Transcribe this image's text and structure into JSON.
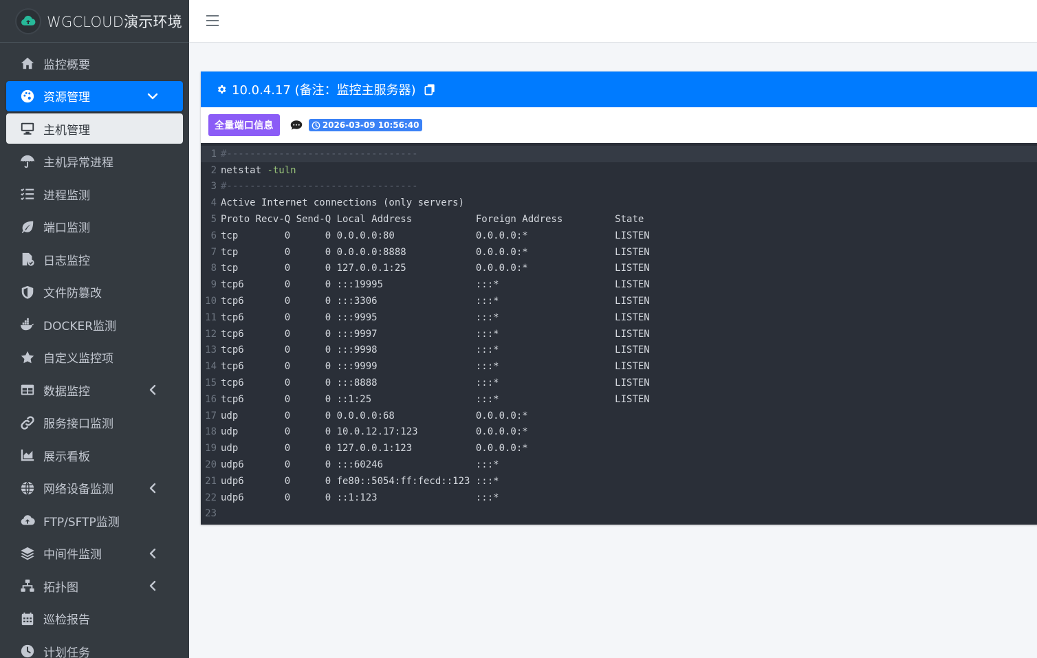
{
  "brand": {
    "title": "WGCLOUD演示环境",
    "logo_icon": "cloud-upload-icon"
  },
  "sidebar": {
    "items": [
      {
        "label": "监控概要",
        "icon": "home-icon"
      },
      {
        "label": "资源管理",
        "icon": "palette-icon",
        "state": "active",
        "arrow": "down"
      },
      {
        "label": "主机管理",
        "icon": "desktop-icon",
        "state": "sub-active"
      },
      {
        "label": "主机异常进程",
        "icon": "umbrella-icon"
      },
      {
        "label": "进程监测",
        "icon": "tasks-icon"
      },
      {
        "label": "端口监测",
        "icon": "leaf-icon"
      },
      {
        "label": "日志监控",
        "icon": "file-check-icon"
      },
      {
        "label": "文件防篡改",
        "icon": "shield-icon"
      },
      {
        "label": "DOCKER监测",
        "icon": "docker-icon"
      },
      {
        "label": "自定义监控项",
        "icon": "star-icon"
      },
      {
        "label": "数据监控",
        "icon": "table-icon",
        "arrow": "left"
      },
      {
        "label": "服务接口监测",
        "icon": "link-icon"
      },
      {
        "label": "展示看板",
        "icon": "area-chart-icon"
      },
      {
        "label": "网络设备监测",
        "icon": "globe-icon",
        "arrow": "left"
      },
      {
        "label": "FTP/SFTP监测",
        "icon": "cloud-upload-icon"
      },
      {
        "label": "中间件监测",
        "icon": "layers-icon",
        "arrow": "left"
      },
      {
        "label": "拓扑图",
        "icon": "sitemap-icon",
        "arrow": "left"
      },
      {
        "label": "巡检报告",
        "icon": "calendar-icon"
      },
      {
        "label": "计划任务",
        "icon": "clock-icon"
      }
    ]
  },
  "header": {
    "menu_icon": "hamburger-icon"
  },
  "card": {
    "title": "10.0.4.17 (备注：监控主服务器)",
    "ports_button": "全量端口信息",
    "timestamp": "2026-03-09 10:56:40",
    "colors": {
      "header": "#007bff",
      "button": "#8b5cf6",
      "badge": "#3b82f6"
    }
  },
  "terminal": {
    "lines": [
      "#---------------------------------",
      "netstat -tuln",
      "#---------------------------------",
      "Active Internet connections (only servers)",
      "Proto Recv-Q Send-Q Local Address           Foreign Address         State",
      "tcp        0      0 0.0.0.0:80              0.0.0.0:*               LISTEN",
      "tcp        0      0 0.0.0.0:8888            0.0.0.0:*               LISTEN",
      "tcp        0      0 127.0.0.1:25            0.0.0.0:*               LISTEN",
      "tcp6       0      0 :::19995                :::*                    LISTEN",
      "tcp6       0      0 :::3306                 :::*                    LISTEN",
      "tcp6       0      0 :::9995                 :::*                    LISTEN",
      "tcp6       0      0 :::9997                 :::*                    LISTEN",
      "tcp6       0      0 :::9998                 :::*                    LISTEN",
      "tcp6       0      0 :::9999                 :::*                    LISTEN",
      "tcp6       0      0 :::8888                 :::*                    LISTEN",
      "tcp6       0      0 ::1:25                  :::*                    LISTEN",
      "udp        0      0 0.0.0.0:68              0.0.0.0:*",
      "udp        0      0 10.0.12.17:123          0.0.0.0:*",
      "udp        0      0 127.0.0.1:123           0.0.0.0:*",
      "udp6       0      0 :::60246                :::*",
      "udp6       0      0 fe80::5054:ff:fecd::123 :::*",
      "udp6       0      0 ::1:123                 :::*",
      ""
    ]
  }
}
